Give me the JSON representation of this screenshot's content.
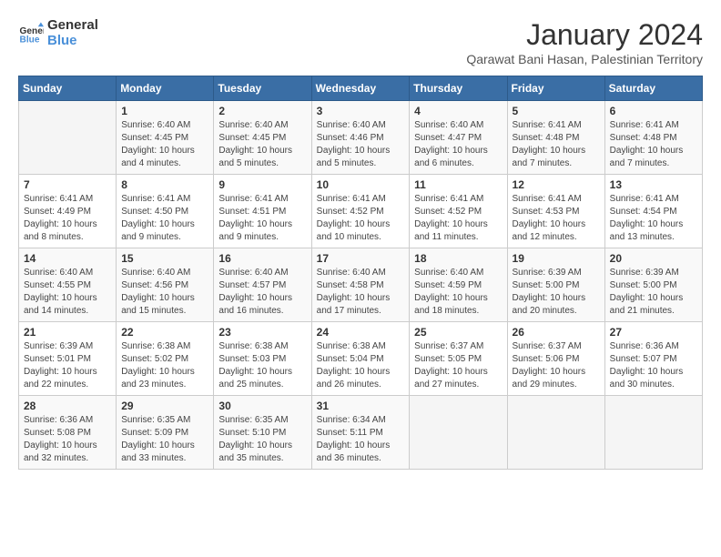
{
  "logo": {
    "line1": "General",
    "line2": "Blue"
  },
  "title": "January 2024",
  "location": "Qarawat Bani Hasan, Palestinian Territory",
  "headers": [
    "Sunday",
    "Monday",
    "Tuesday",
    "Wednesday",
    "Thursday",
    "Friday",
    "Saturday"
  ],
  "weeks": [
    [
      {
        "day": "",
        "sunrise": "",
        "sunset": "",
        "daylight": ""
      },
      {
        "day": "1",
        "sunrise": "Sunrise: 6:40 AM",
        "sunset": "Sunset: 4:45 PM",
        "daylight": "Daylight: 10 hours and 4 minutes."
      },
      {
        "day": "2",
        "sunrise": "Sunrise: 6:40 AM",
        "sunset": "Sunset: 4:45 PM",
        "daylight": "Daylight: 10 hours and 5 minutes."
      },
      {
        "day": "3",
        "sunrise": "Sunrise: 6:40 AM",
        "sunset": "Sunset: 4:46 PM",
        "daylight": "Daylight: 10 hours and 5 minutes."
      },
      {
        "day": "4",
        "sunrise": "Sunrise: 6:40 AM",
        "sunset": "Sunset: 4:47 PM",
        "daylight": "Daylight: 10 hours and 6 minutes."
      },
      {
        "day": "5",
        "sunrise": "Sunrise: 6:41 AM",
        "sunset": "Sunset: 4:48 PM",
        "daylight": "Daylight: 10 hours and 7 minutes."
      },
      {
        "day": "6",
        "sunrise": "Sunrise: 6:41 AM",
        "sunset": "Sunset: 4:48 PM",
        "daylight": "Daylight: 10 hours and 7 minutes."
      }
    ],
    [
      {
        "day": "7",
        "sunrise": "Sunrise: 6:41 AM",
        "sunset": "Sunset: 4:49 PM",
        "daylight": "Daylight: 10 hours and 8 minutes."
      },
      {
        "day": "8",
        "sunrise": "Sunrise: 6:41 AM",
        "sunset": "Sunset: 4:50 PM",
        "daylight": "Daylight: 10 hours and 9 minutes."
      },
      {
        "day": "9",
        "sunrise": "Sunrise: 6:41 AM",
        "sunset": "Sunset: 4:51 PM",
        "daylight": "Daylight: 10 hours and 9 minutes."
      },
      {
        "day": "10",
        "sunrise": "Sunrise: 6:41 AM",
        "sunset": "Sunset: 4:52 PM",
        "daylight": "Daylight: 10 hours and 10 minutes."
      },
      {
        "day": "11",
        "sunrise": "Sunrise: 6:41 AM",
        "sunset": "Sunset: 4:52 PM",
        "daylight": "Daylight: 10 hours and 11 minutes."
      },
      {
        "day": "12",
        "sunrise": "Sunrise: 6:41 AM",
        "sunset": "Sunset: 4:53 PM",
        "daylight": "Daylight: 10 hours and 12 minutes."
      },
      {
        "day": "13",
        "sunrise": "Sunrise: 6:41 AM",
        "sunset": "Sunset: 4:54 PM",
        "daylight": "Daylight: 10 hours and 13 minutes."
      }
    ],
    [
      {
        "day": "14",
        "sunrise": "Sunrise: 6:40 AM",
        "sunset": "Sunset: 4:55 PM",
        "daylight": "Daylight: 10 hours and 14 minutes."
      },
      {
        "day": "15",
        "sunrise": "Sunrise: 6:40 AM",
        "sunset": "Sunset: 4:56 PM",
        "daylight": "Daylight: 10 hours and 15 minutes."
      },
      {
        "day": "16",
        "sunrise": "Sunrise: 6:40 AM",
        "sunset": "Sunset: 4:57 PM",
        "daylight": "Daylight: 10 hours and 16 minutes."
      },
      {
        "day": "17",
        "sunrise": "Sunrise: 6:40 AM",
        "sunset": "Sunset: 4:58 PM",
        "daylight": "Daylight: 10 hours and 17 minutes."
      },
      {
        "day": "18",
        "sunrise": "Sunrise: 6:40 AM",
        "sunset": "Sunset: 4:59 PM",
        "daylight": "Daylight: 10 hours and 18 minutes."
      },
      {
        "day": "19",
        "sunrise": "Sunrise: 6:39 AM",
        "sunset": "Sunset: 5:00 PM",
        "daylight": "Daylight: 10 hours and 20 minutes."
      },
      {
        "day": "20",
        "sunrise": "Sunrise: 6:39 AM",
        "sunset": "Sunset: 5:00 PM",
        "daylight": "Daylight: 10 hours and 21 minutes."
      }
    ],
    [
      {
        "day": "21",
        "sunrise": "Sunrise: 6:39 AM",
        "sunset": "Sunset: 5:01 PM",
        "daylight": "Daylight: 10 hours and 22 minutes."
      },
      {
        "day": "22",
        "sunrise": "Sunrise: 6:38 AM",
        "sunset": "Sunset: 5:02 PM",
        "daylight": "Daylight: 10 hours and 23 minutes."
      },
      {
        "day": "23",
        "sunrise": "Sunrise: 6:38 AM",
        "sunset": "Sunset: 5:03 PM",
        "daylight": "Daylight: 10 hours and 25 minutes."
      },
      {
        "day": "24",
        "sunrise": "Sunrise: 6:38 AM",
        "sunset": "Sunset: 5:04 PM",
        "daylight": "Daylight: 10 hours and 26 minutes."
      },
      {
        "day": "25",
        "sunrise": "Sunrise: 6:37 AM",
        "sunset": "Sunset: 5:05 PM",
        "daylight": "Daylight: 10 hours and 27 minutes."
      },
      {
        "day": "26",
        "sunrise": "Sunrise: 6:37 AM",
        "sunset": "Sunset: 5:06 PM",
        "daylight": "Daylight: 10 hours and 29 minutes."
      },
      {
        "day": "27",
        "sunrise": "Sunrise: 6:36 AM",
        "sunset": "Sunset: 5:07 PM",
        "daylight": "Daylight: 10 hours and 30 minutes."
      }
    ],
    [
      {
        "day": "28",
        "sunrise": "Sunrise: 6:36 AM",
        "sunset": "Sunset: 5:08 PM",
        "daylight": "Daylight: 10 hours and 32 minutes."
      },
      {
        "day": "29",
        "sunrise": "Sunrise: 6:35 AM",
        "sunset": "Sunset: 5:09 PM",
        "daylight": "Daylight: 10 hours and 33 minutes."
      },
      {
        "day": "30",
        "sunrise": "Sunrise: 6:35 AM",
        "sunset": "Sunset: 5:10 PM",
        "daylight": "Daylight: 10 hours and 35 minutes."
      },
      {
        "day": "31",
        "sunrise": "Sunrise: 6:34 AM",
        "sunset": "Sunset: 5:11 PM",
        "daylight": "Daylight: 10 hours and 36 minutes."
      },
      {
        "day": "",
        "sunrise": "",
        "sunset": "",
        "daylight": ""
      },
      {
        "day": "",
        "sunrise": "",
        "sunset": "",
        "daylight": ""
      },
      {
        "day": "",
        "sunrise": "",
        "sunset": "",
        "daylight": ""
      }
    ]
  ]
}
